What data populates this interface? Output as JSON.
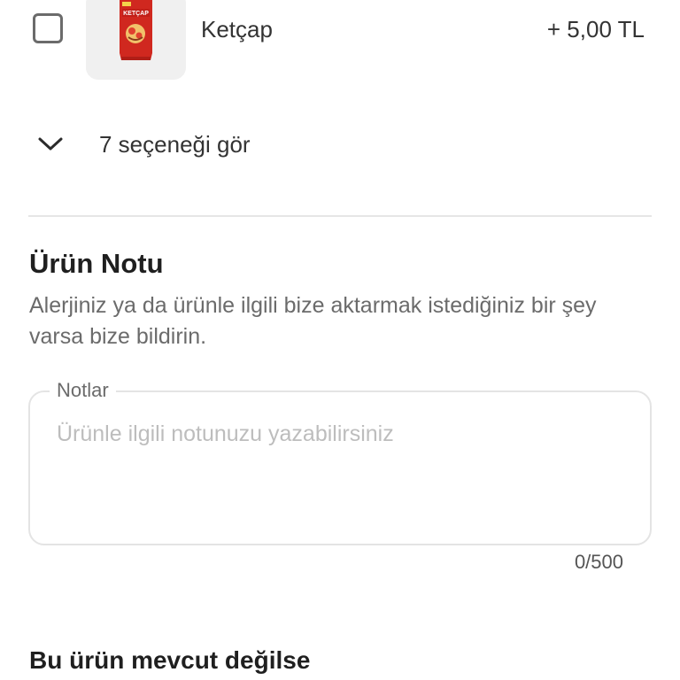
{
  "option": {
    "name": "Ketçap",
    "price": "+ 5,00 TL",
    "checked": false,
    "image_icon": "ketchup-packet-image",
    "image_brand_text": "KETÇAP"
  },
  "expand": {
    "label": "7 seçeneği gör",
    "icon": "chevron-down-icon"
  },
  "product_note": {
    "title": "Ürün Notu",
    "description": "Alerjiniz ya da ürünle ilgili bize aktarmak istediğiniz bir şey varsa bize bildirin.",
    "field_label": "Notlar",
    "placeholder": "Ürünle ilgili notunuzu yazabilirsiniz",
    "value": "",
    "counter": "0/500"
  },
  "unavailable_section": {
    "title": "Bu ürün mevcut değilse"
  },
  "colors": {
    "text_primary": "#1f1f1f",
    "text_secondary": "#6b6b6b",
    "placeholder": "#bdbdbd",
    "border": "#e4e4e4",
    "ketchup_red": "#d0281f"
  }
}
